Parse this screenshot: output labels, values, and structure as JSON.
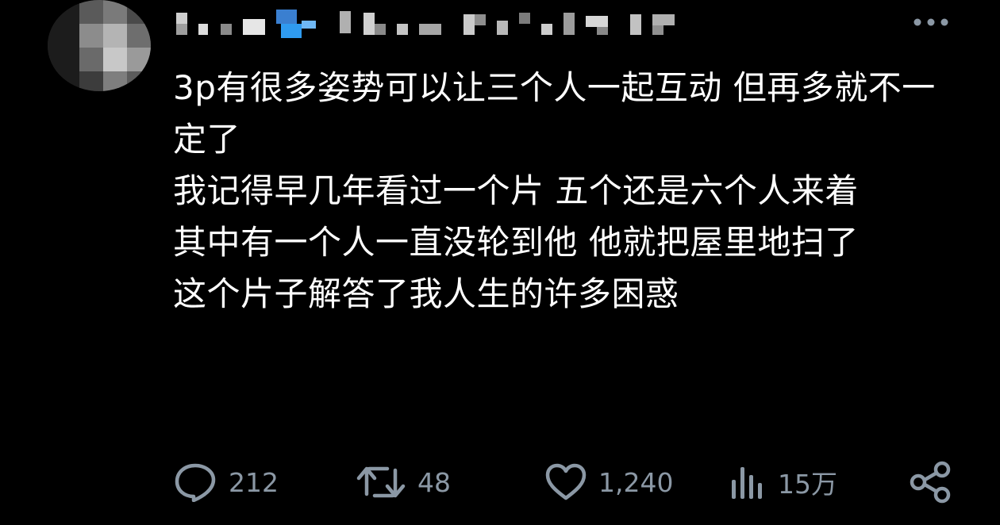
{
  "post": {
    "text_lines": [
      "3p有很多姿势可以让三个人一起互动 但再多就不一定了",
      "我记得早几年看过一个片 五个还是六个人来着",
      "其中有一个人一直没轮到他 他就把屋里地扫了",
      "这个片子解答了我人生的许多困惑"
    ]
  },
  "actions": {
    "replies": "212",
    "reposts": "48",
    "likes": "1,240",
    "views": "15万"
  },
  "icons": {
    "reply": "reply-bubble-icon",
    "repost": "repost-icon",
    "like": "heart-icon",
    "views": "analytics-icon",
    "share": "share-icon",
    "more": "more-icon"
  },
  "colors": {
    "background": "#000000",
    "text": "#ffffff",
    "muted": "#8b98a5",
    "verified_blue": "#1d9bf0"
  }
}
